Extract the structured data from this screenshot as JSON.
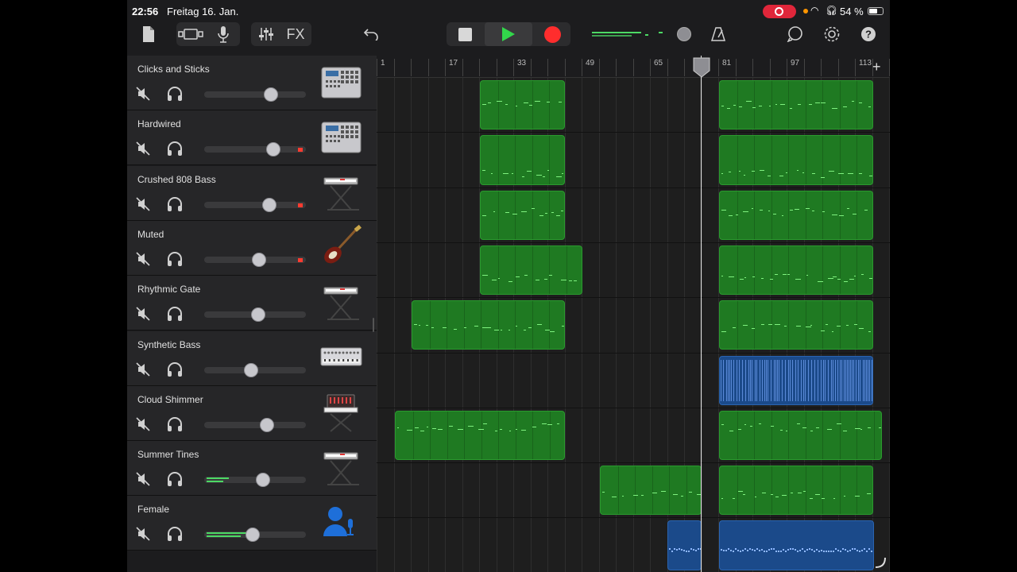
{
  "status": {
    "time": "22:56",
    "date": "Freitag 16. Jan.",
    "battery": "54 %"
  },
  "toolbar": {
    "fx_label": "FX"
  },
  "ruler": {
    "labels": [
      "1",
      "17",
      "33",
      "49",
      "65",
      "81",
      "97",
      "113"
    ]
  },
  "tracks": [
    {
      "name": "Clicks and Sticks",
      "instrument": "drum-machine-icon",
      "volume": 0.66,
      "meter": 0,
      "rec": false
    },
    {
      "name": "Hardwired",
      "instrument": "drum-machine-icon",
      "volume": 0.68,
      "meter": 0,
      "rec": true
    },
    {
      "name": "Crushed 808 Bass",
      "instrument": "keyboard-stand-icon",
      "volume": 0.64,
      "meter": 0,
      "rec": true
    },
    {
      "name": "Muted",
      "instrument": "bass-guitar-icon",
      "volume": 0.54,
      "meter": 0,
      "rec": true
    },
    {
      "name": "Rhythmic Gate",
      "instrument": "keyboard-stand-icon",
      "volume": 0.53,
      "meter": 0,
      "rec": false
    },
    {
      "name": "Synthetic Bass",
      "instrument": "synth-module-icon",
      "volume": 0.46,
      "meter": 0,
      "rec": false
    },
    {
      "name": "Cloud Shimmer",
      "instrument": "synth-stand-icon",
      "volume": 0.62,
      "meter": 0,
      "rec": false
    },
    {
      "name": "Summer Tines",
      "instrument": "keyboard-stand-icon",
      "volume": 0.58,
      "meter": 0.22,
      "rec": false
    },
    {
      "name": "Female",
      "instrument": "vocalist-icon",
      "volume": 0.48,
      "meter": 0.45,
      "rec": false
    }
  ],
  "colors": {
    "region_green": "#1f7a22",
    "region_blue": "#1b4a8a",
    "play": "#32d74b",
    "record": "#ff2d2d"
  }
}
